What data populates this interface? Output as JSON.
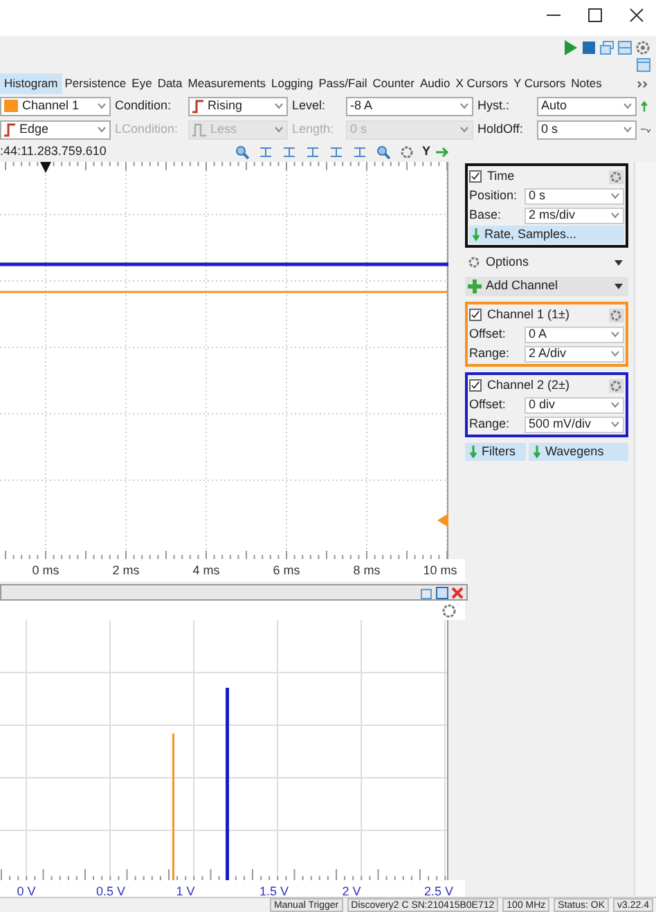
{
  "tabs": [
    {
      "label": "Histogram",
      "selected": true
    },
    {
      "label": "Persistence",
      "selected": false
    },
    {
      "label": "Eye",
      "selected": false
    },
    {
      "label": "Data",
      "selected": false
    },
    {
      "label": "Measurements",
      "selected": false
    },
    {
      "label": "Logging",
      "selected": false
    },
    {
      "label": "Pass/Fail",
      "selected": false
    },
    {
      "label": "Counter",
      "selected": false
    },
    {
      "label": "Audio",
      "selected": false
    },
    {
      "label": "X Cursors",
      "selected": false
    },
    {
      "label": "Y Cursors",
      "selected": false
    },
    {
      "label": "Notes",
      "selected": false
    }
  ],
  "trigger_rows": [
    [
      {
        "kind": "channel",
        "value": "Channel 1",
        "color": "#f7931e",
        "disabled": false
      },
      {
        "kind": "edge",
        "label": "Condition:",
        "value": "Rising",
        "disabled": false
      },
      {
        "kind": "plain",
        "label": "Level:",
        "value": "-8 A",
        "disabled": false
      },
      {
        "kind": "plain",
        "label": "Hyst.:",
        "value": "Auto",
        "disabled": false
      }
    ],
    [
      {
        "kind": "edge",
        "value": "Edge",
        "disabled": false
      },
      {
        "kind": "pulse",
        "label": "LCondition:",
        "value": "Less",
        "disabled": true
      },
      {
        "kind": "plain",
        "label": "Length:",
        "value": "0 s",
        "disabled": true
      },
      {
        "kind": "plain",
        "label": "HoldOff:",
        "value": "0 s",
        "disabled": false
      }
    ]
  ],
  "timestamp": ":44:11.283.759.610",
  "y_label": "Y",
  "time_panel": {
    "title": "Time",
    "checked": true,
    "fields": [
      {
        "label": "Position:",
        "value": "0 s"
      },
      {
        "label": "Base:",
        "value": "2 ms/div"
      }
    ],
    "button": "Rate, Samples..."
  },
  "options": "Options",
  "add_channel": "Add Channel",
  "channels": [
    {
      "title": "Channel 1 (1±)",
      "checked": true,
      "color": "#f7931e",
      "offset_label": "Offset:",
      "offset": "0 A",
      "range_label": "Range:",
      "range": "2 A/div"
    },
    {
      "title": "Channel 2 (2±)",
      "checked": true,
      "color": "#1c1cc8",
      "offset_label": "Offset:",
      "offset": "0 div",
      "range_label": "Range:",
      "range": "500 mV/div"
    }
  ],
  "panel_buttons": [
    "Filters",
    "Wavegens"
  ],
  "time_axis": [
    "0 ms",
    "2 ms",
    "4 ms",
    "6 ms",
    "8 ms",
    "10 ms"
  ],
  "histogram_axis": [
    "0 V",
    "0.5 V",
    "1 V",
    "1.5 V",
    "2 V",
    "2.5 V"
  ],
  "status_bar": [
    "Manual Trigger",
    "Discovery2 C SN:210415B0E712",
    "100 MHz",
    "Status: OK",
    "v3.22.4"
  ]
}
